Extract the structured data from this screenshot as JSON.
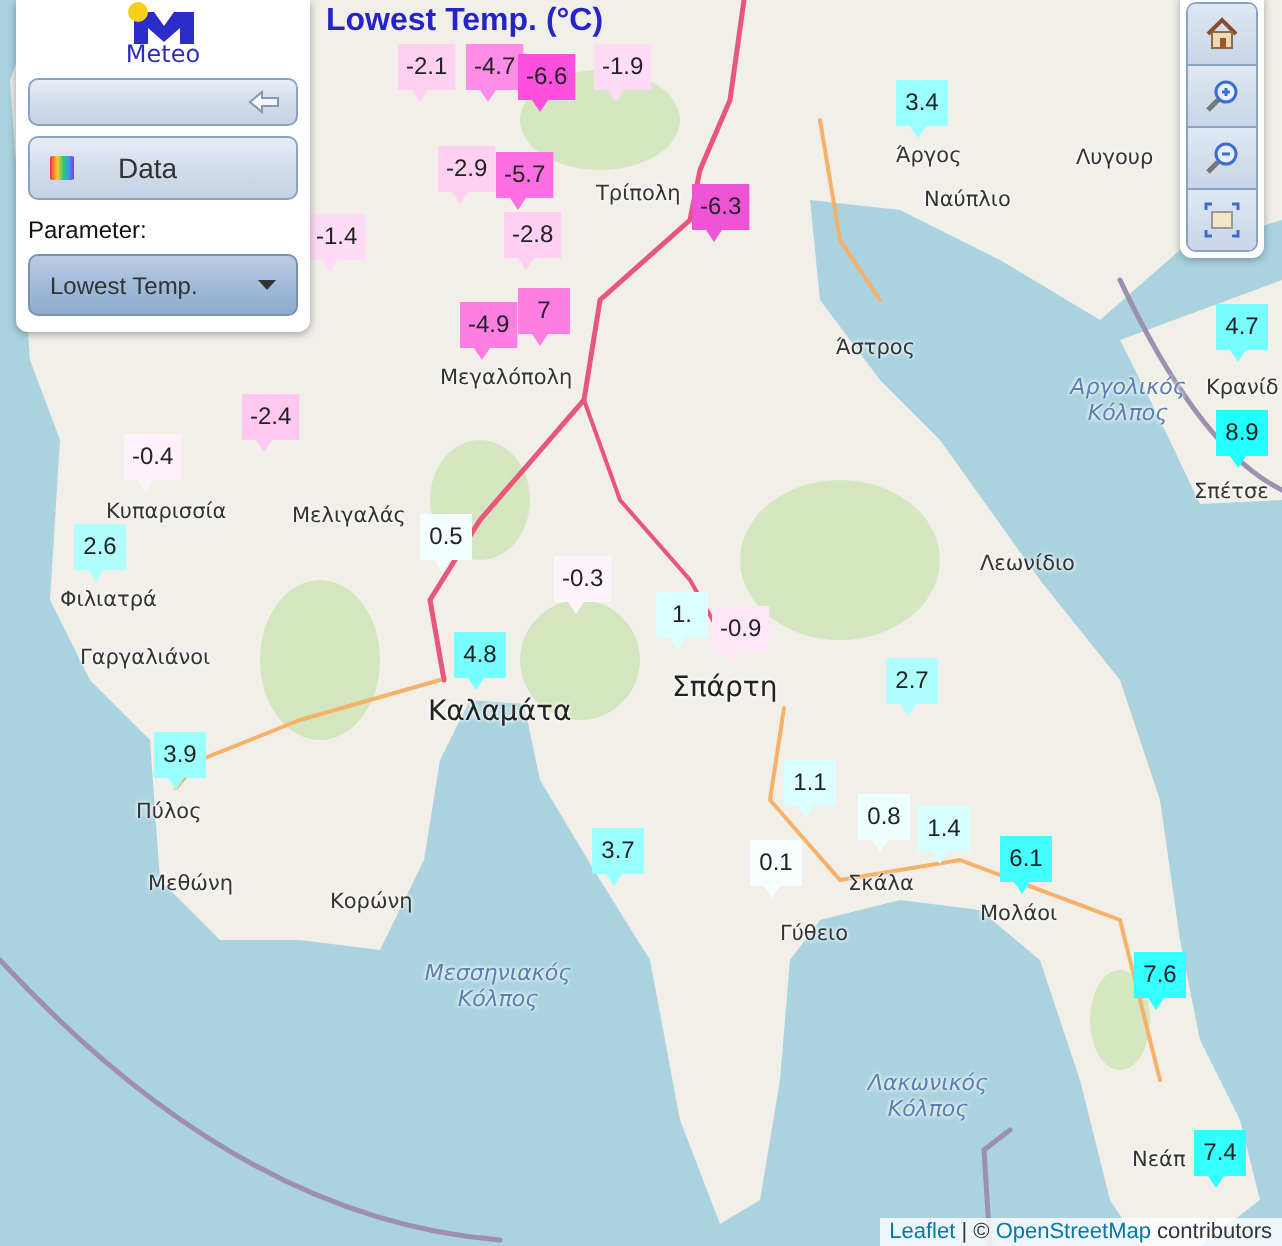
{
  "title": "Lowest Temp. (°C)",
  "panel": {
    "logo_text": "Meteo",
    "data_button": "Data",
    "parameter": {
      "label": "Parameter:",
      "value": "Lowest Temp."
    }
  },
  "map_tools": [
    {
      "kind": "home"
    },
    {
      "kind": "zoom_in"
    },
    {
      "kind": "zoom_out"
    },
    {
      "kind": "extent"
    }
  ],
  "places": [
    {
      "name": "Άργος",
      "kind": "town"
    },
    {
      "name": "Ναύπλιο",
      "kind": "town"
    },
    {
      "name": "Λυγουρ",
      "kind": "town"
    },
    {
      "name": "Τρίπολη",
      "kind": "town"
    },
    {
      "name": "Άστρος",
      "kind": "town"
    },
    {
      "name": "Αργολικός Κόλπος",
      "kind": "sea"
    },
    {
      "name": "Κρανίδ",
      "kind": "town"
    },
    {
      "name": "Σπέτσε",
      "kind": "town"
    },
    {
      "name": "Μεγαλόπολη",
      "kind": "town"
    },
    {
      "name": "Κυπαρισσία",
      "kind": "town"
    },
    {
      "name": "Φιλιατρά",
      "kind": "town"
    },
    {
      "name": "Μελιγαλάς",
      "kind": "town"
    },
    {
      "name": "Γαργαλιάνοι",
      "kind": "town"
    },
    {
      "name": "Καλαμάτα",
      "kind": "city"
    },
    {
      "name": "Πύλος",
      "kind": "town"
    },
    {
      "name": "Μεθώνη",
      "kind": "town"
    },
    {
      "name": "Κορώνη",
      "kind": "town"
    },
    {
      "name": "Λεωνίδιο",
      "kind": "town"
    },
    {
      "name": "Σπάρτη",
      "kind": "city"
    },
    {
      "name": "Σκάλα",
      "kind": "town"
    },
    {
      "name": "Γύθειο",
      "kind": "town"
    },
    {
      "name": "Μολάοι",
      "kind": "town"
    },
    {
      "name": "Μεσσηνιακός Κόλπος",
      "kind": "sea"
    },
    {
      "name": "Λακωνικός Κόλπος",
      "kind": "sea"
    },
    {
      "name": "Νεάπ",
      "kind": "town"
    }
  ],
  "markers": [
    {
      "value": "-2.1",
      "color": "#ffd0f2"
    },
    {
      "value": "-4.7",
      "color": "#ff8ce6"
    },
    {
      "value": "-6.6",
      "color": "#ff4fde"
    },
    {
      "value": "-1.9",
      "color": "#ffdcf5"
    },
    {
      "value": "-2.9",
      "color": "#ffd0f2"
    },
    {
      "value": "-5.7",
      "color": "#ff6fe2"
    },
    {
      "value": "-2.8",
      "color": "#ffd0f2"
    },
    {
      "value": "-1.4",
      "color": "#ffdcf5"
    },
    {
      "value": "7",
      "color": "#ff7ee4"
    },
    {
      "value": "-4.9",
      "color": "#ff7ee4"
    },
    {
      "value": "-6.3",
      "color": "#ee55d6"
    },
    {
      "value": "3.4",
      "color": "#99ffff"
    },
    {
      "value": "4.7",
      "color": "#77ffff"
    },
    {
      "value": "8.9",
      "color": "#22ffff"
    },
    {
      "value": "-2.4",
      "color": "#ffc8f0"
    },
    {
      "value": "-0.4",
      "color": "#fff0fa"
    },
    {
      "value": "2.6",
      "color": "#b0ffff"
    },
    {
      "value": "0.5",
      "color": "#f4ffff"
    },
    {
      "value": "-0.3",
      "color": "#fff4fb"
    },
    {
      "value": "1.",
      "color": "#dcffff"
    },
    {
      "value": "-0.9",
      "color": "#ffe6f7"
    },
    {
      "value": "4.8",
      "color": "#77ffff"
    },
    {
      "value": "2.7",
      "color": "#b0ffff"
    },
    {
      "value": "3.9",
      "color": "#99ffff"
    },
    {
      "value": "1.1",
      "color": "#dcffff"
    },
    {
      "value": "0.8",
      "color": "#eeffff"
    },
    {
      "value": "1.4",
      "color": "#d8ffff"
    },
    {
      "value": "3.7",
      "color": "#99ffff"
    },
    {
      "value": "0.1",
      "color": "#f8ffff"
    },
    {
      "value": "6.1",
      "color": "#44ffff"
    },
    {
      "value": "7.6",
      "color": "#33ffff"
    },
    {
      "value": "7.4",
      "color": "#33ffff"
    }
  ],
  "attribution": {
    "leaflet_link": "Leaflet",
    "separator": " | © ",
    "osm_link": "OpenStreetMap",
    "suffix": " contributors"
  }
}
